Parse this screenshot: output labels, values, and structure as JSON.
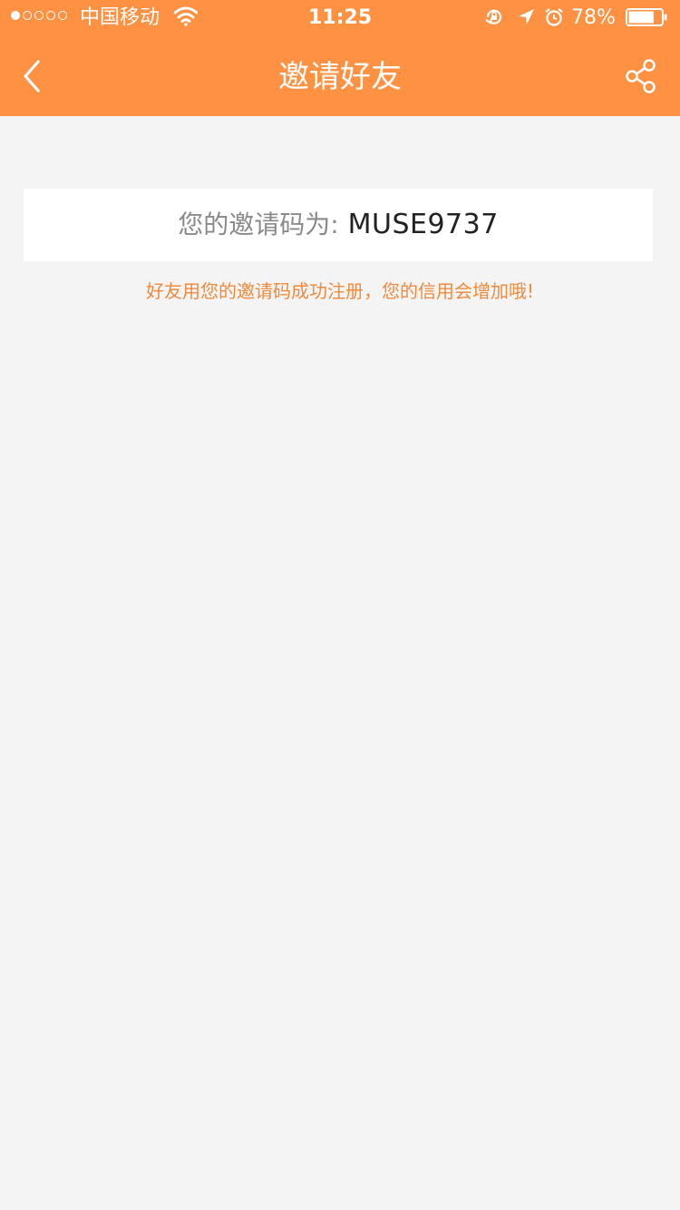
{
  "status_bar": {
    "carrier": "中国移动",
    "time": "11:25",
    "battery_percent": "78%",
    "battery_level": 0.78,
    "signal_bars_filled": 1,
    "signal_bars_total": 5
  },
  "nav": {
    "title": "邀请好友",
    "back_icon": "chevron-left-icon",
    "share_icon": "share-icon"
  },
  "invite": {
    "label": "您的邀请码为:",
    "code": "MUSE9737",
    "hint": "好友用您的邀请码成功注册，您的信用会增加哦!"
  },
  "colors": {
    "accent": "#ff9142",
    "hint_text": "#f08a3c",
    "background": "#f4f4f4"
  }
}
